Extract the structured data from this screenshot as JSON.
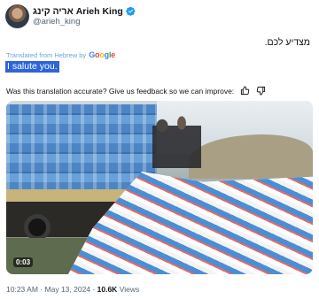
{
  "author": {
    "display_name": "אריה קינג Arieh King",
    "handle": "@arieh_king",
    "verified_color": "#1d9bf0"
  },
  "tweet": {
    "text": "מצדיע לכם.",
    "translated_from": "Translated from Hebrew by",
    "translation_provider": "Google",
    "translation": "I salute you.",
    "feedback_prompt": "Was this translation accurate? Give us feedback so we can improve:"
  },
  "media": {
    "type": "video",
    "duration": "0:03"
  },
  "meta": {
    "time": "10:23 AM",
    "separator": "·",
    "date": "May 13, 2024",
    "views_count": "10.6K",
    "views_label": "Views"
  },
  "colors": {
    "accent": "#1d9bf0",
    "selection": "#2f64d9",
    "secondary_text": "#536471"
  }
}
